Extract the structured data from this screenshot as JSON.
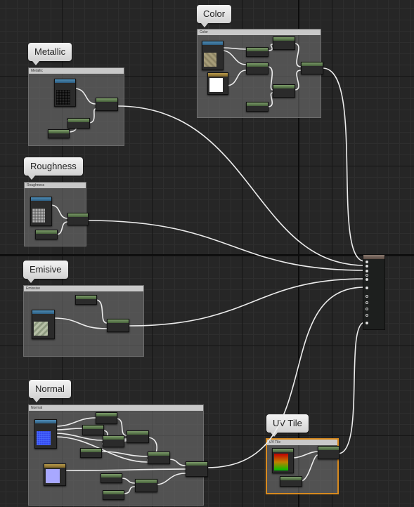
{
  "graph": {
    "comments": {
      "color": {
        "bubble": "Color",
        "title": "Color"
      },
      "metallic": {
        "bubble": "Metallic",
        "title": "Metallic"
      },
      "roughness": {
        "bubble": "Roughness",
        "title": "Roughness"
      },
      "emisive": {
        "bubble": "Emisive",
        "title": "Emissive"
      },
      "normal": {
        "bubble": "Normal",
        "title": "Normal"
      },
      "uv_tile": {
        "bubble": "UV Tile",
        "title": "UV Tile"
      }
    },
    "colors": {
      "background": "#262626",
      "wire": "#ececec",
      "node_header_green": "#5f7f4f",
      "texture_header_blue": "#3c78a0",
      "parameter_header_gold": "#a08232",
      "selection_outline": "#d88a1e"
    },
    "icons": [
      "material-output-node",
      "texture-sample-node",
      "constant-node",
      "math-node"
    ]
  }
}
